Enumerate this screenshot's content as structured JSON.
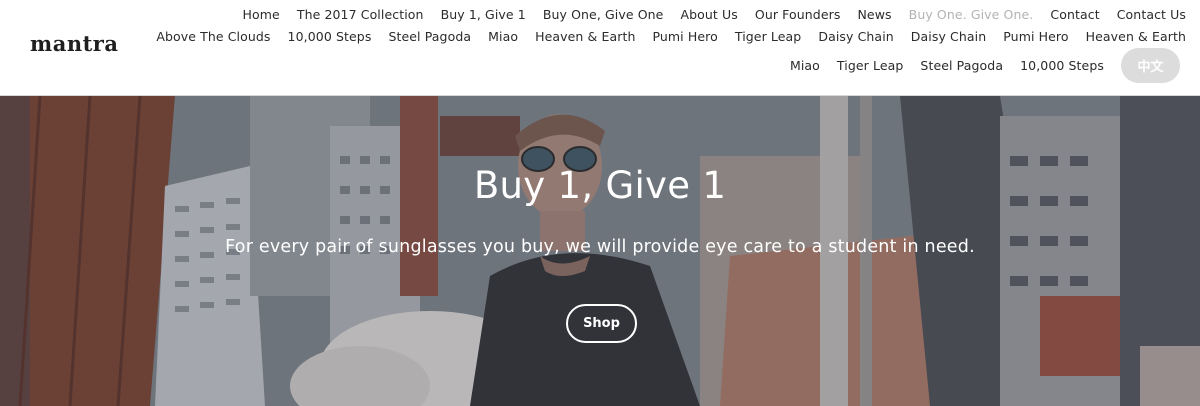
{
  "brand": {
    "logo": "mantra"
  },
  "nav": {
    "row1": [
      {
        "label": "Home",
        "active": false
      },
      {
        "label": "The 2017 Collection",
        "active": false
      },
      {
        "label": "Buy 1, Give 1",
        "active": false
      },
      {
        "label": "Buy One, Give One",
        "active": false
      },
      {
        "label": "About Us",
        "active": false
      },
      {
        "label": "Our Founders",
        "active": false
      },
      {
        "label": "News",
        "active": false
      },
      {
        "label": "Buy One. Give One.",
        "active": true
      },
      {
        "label": "Contact",
        "active": false
      },
      {
        "label": "Contact Us",
        "active": false
      }
    ],
    "row2": [
      {
        "label": "Above The Clouds"
      },
      {
        "label": "10,000 Steps"
      },
      {
        "label": "Steel Pagoda"
      },
      {
        "label": "Miao"
      },
      {
        "label": "Heaven & Earth"
      },
      {
        "label": "Pumi Hero"
      },
      {
        "label": "Tiger Leap"
      },
      {
        "label": "Daisy Chain"
      },
      {
        "label": "Daisy Chain"
      },
      {
        "label": "Pumi Hero"
      },
      {
        "label": "Heaven & Earth"
      }
    ],
    "row3": [
      {
        "label": "Miao"
      },
      {
        "label": "Tiger Leap"
      },
      {
        "label": "Steel Pagoda"
      },
      {
        "label": "10,000 Steps"
      }
    ],
    "language_button": "中文"
  },
  "hero": {
    "title": "Buy 1, Give 1",
    "subtitle": "For every pair of sunglasses you buy, we will provide eye care to a student in need.",
    "cta_label": "Shop"
  },
  "colors": {
    "nav_text": "#2b2b2b",
    "nav_active": "#b3b3b3",
    "language_button_bg": "#dcdcdc",
    "hero_text": "#ffffff"
  }
}
